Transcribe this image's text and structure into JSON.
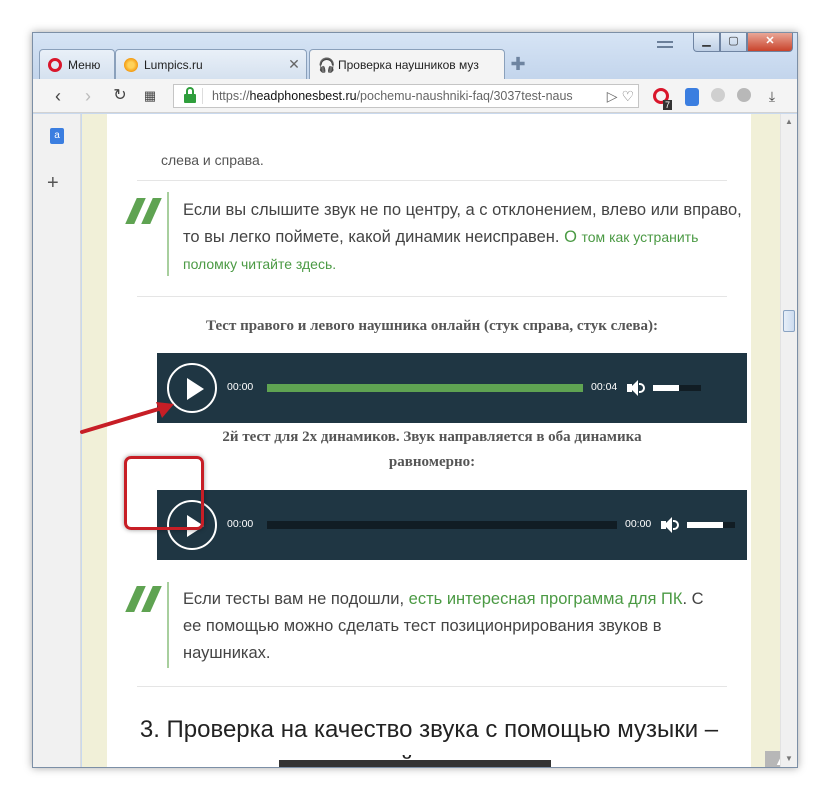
{
  "tabs": [
    {
      "label": "Меню",
      "icon": "opera-icon"
    },
    {
      "label": "Lumpics.ru",
      "icon": "lumpics-favicon"
    },
    {
      "label": "Проверка наушников муз",
      "icon": "headphones-favicon"
    }
  ],
  "toolbar": {
    "url_prefix": "https://",
    "url_domain": "headphonesbest.ru",
    "url_path": "/pochemu-naushniki-faq/3037test-naus",
    "ext_badge": "7"
  },
  "article": {
    "top_text": "слева и справа.",
    "quote1": {
      "text": "Если вы слышите звук не по центру, а с отклонением, влево или вправо, то вы легко поймете, какой динамик неисправен.",
      "link_part1": "О",
      "link_part2": "том как устранить поломку читайте здесь."
    },
    "caption1": "Тест правого и левого наушника онлайн (стук справа, стук слева):",
    "player1": {
      "current": "00:00",
      "duration": "00:04",
      "progress": 1.0,
      "volume": 0.55
    },
    "caption2_line1": "2й тест для 2х динамиков. Звук направляется в оба динамика",
    "caption2_line2": "равномерно:",
    "player2": {
      "current": "00:00",
      "duration": "00:00",
      "progress": 0.0,
      "volume": 0.75
    },
    "quote2": {
      "text_before": "Если тесты вам не подошли,",
      "link": "есть интересная программа для ПК",
      "text_after": ". С ее помощью можно сделать тест позиционрирования звуков в наушниках."
    },
    "heading_line1": "3. Проверка на качество звука с помощью музыки –",
    "heading_line2": "тестовый аудио-трек:"
  },
  "colors": {
    "player_bg": "#1f3643",
    "progress": "#5fa352",
    "accent_green": "#4b9a44",
    "highlight_red": "#c71e26"
  }
}
